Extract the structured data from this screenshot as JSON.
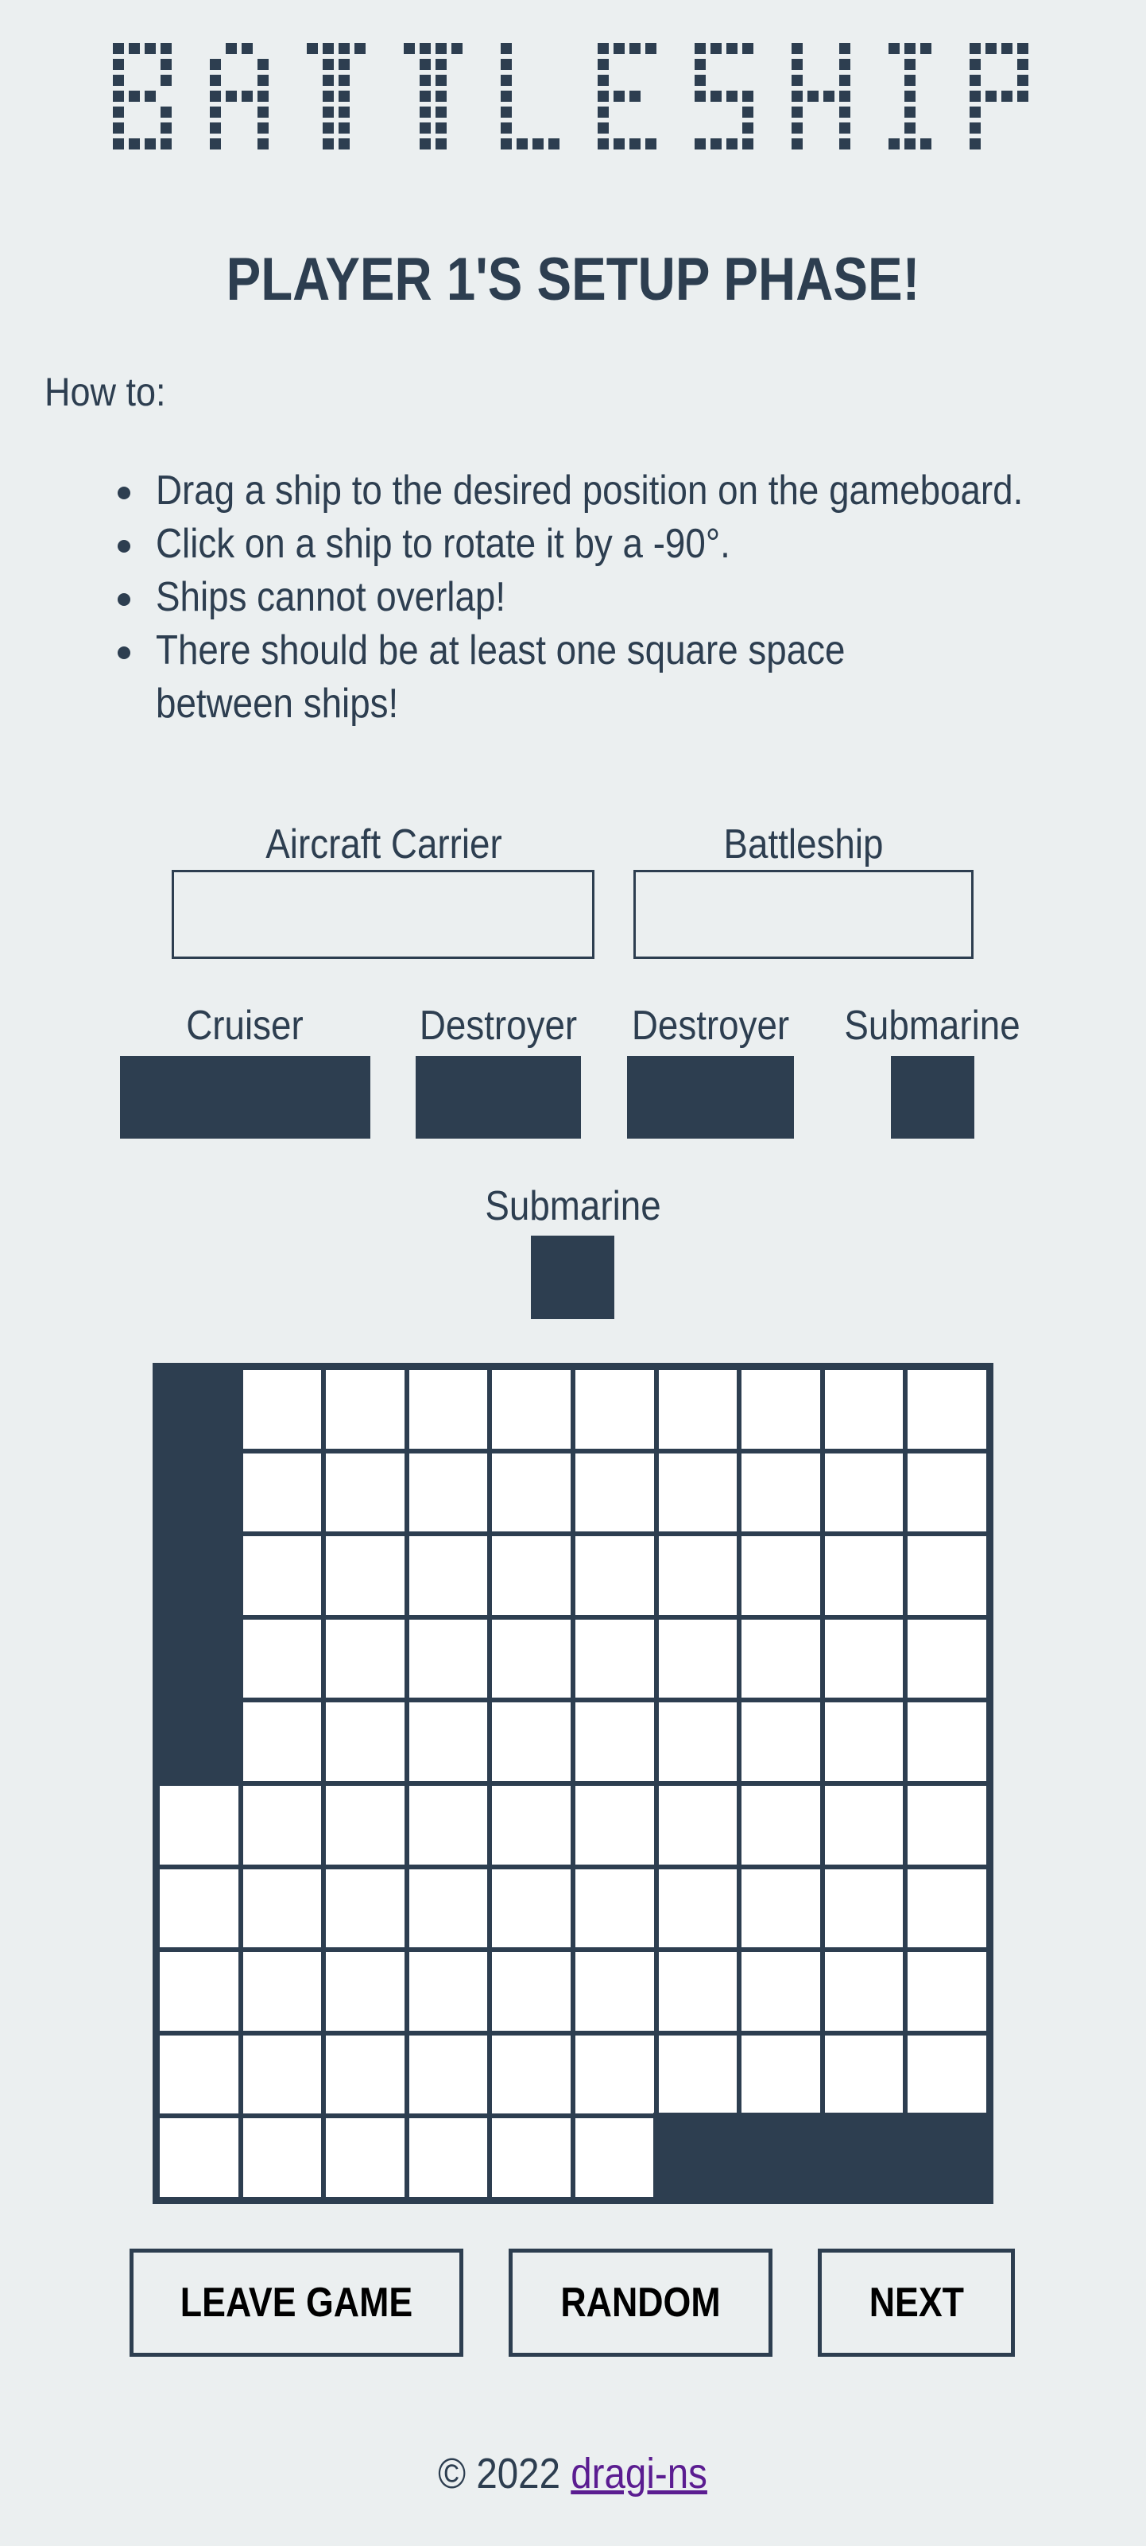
{
  "app": {
    "title": "BATTLESHIP",
    "phase_title": "PLAYER 1'S SETUP PHASE!"
  },
  "howto": {
    "label": "How to:",
    "rules": [
      "Drag a ship to the desired position on the gameboard.",
      "Click on a ship to rotate it by a -90°.",
      "Ships cannot overlap!",
      "There should be at least one square space between ships!"
    ]
  },
  "ships": {
    "aircraft_carrier": "Aircraft Carrier",
    "battleship": "Battleship",
    "cruiser": "Cruiser",
    "destroyer_1": "Destroyer",
    "destroyer_2": "Destroyer",
    "submarine_1": "Submarine",
    "submarine_2": "Submarine"
  },
  "board": {
    "rows": 10,
    "cols": 10,
    "placed_ships": [
      {
        "name": "Aircraft Carrier",
        "row": 1,
        "col": 1,
        "length": 5,
        "orientation": "vertical"
      },
      {
        "name": "Battleship",
        "row": 10,
        "col": 7,
        "length": 4,
        "orientation": "horizontal"
      }
    ]
  },
  "buttons": {
    "leave": "LEAVE GAME",
    "random": "RANDOM",
    "next": "NEXT"
  },
  "footer": {
    "copyright": "© 2022",
    "author_link": "dragi-ns"
  },
  "colors": {
    "background": "#ebeff0",
    "primary": "#2d3e50",
    "link": "#5b1d91"
  }
}
